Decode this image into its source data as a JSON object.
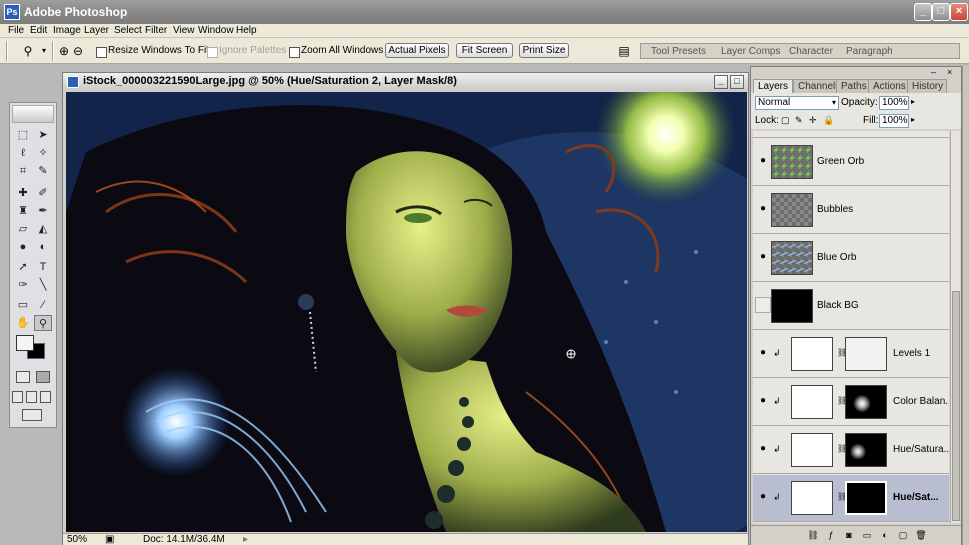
{
  "app": {
    "title": "Adobe Photoshop",
    "logo_text": "Ps"
  },
  "menu": [
    "File",
    "Edit",
    "Image",
    "Layer",
    "Select",
    "Filter",
    "View",
    "Window",
    "Help"
  ],
  "options": {
    "zoom_icon": "zoom-icon",
    "resize_windows": "Resize Windows To Fit",
    "ignore_palettes": "Ignore Palettes",
    "zoom_all_windows": "Zoom All Windows",
    "actual_pixels": "Actual Pixels",
    "fit_screen": "Fit Screen",
    "print_size": "Print Size"
  },
  "palette_well": [
    "Tool Presets",
    "Layer Comps",
    "Character",
    "Paragraph"
  ],
  "document": {
    "title": "iStock_000003221590Large.jpg @ 50% (Hue/Saturation 2, Layer Mask/8)",
    "zoom": "50%",
    "doc_size": "Doc: 14.1M/36.4M"
  },
  "layers_panel": {
    "tabs": [
      "Layers",
      "Channels",
      "Paths",
      "Actions",
      "History"
    ],
    "blend_mode": "Normal",
    "opacity_label": "Opacity:",
    "opacity": "100%",
    "lock_label": "Lock:",
    "fill_label": "Fill:",
    "fill": "100%",
    "layers": [
      {
        "name": "Green Orb",
        "visible": true
      },
      {
        "name": "Bubbles",
        "visible": true
      },
      {
        "name": "Blue Orb",
        "visible": true
      },
      {
        "name": "Black BG",
        "visible": false
      },
      {
        "name": "Levels 1",
        "visible": true
      },
      {
        "name": "Color Balan...",
        "visible": true
      },
      {
        "name": "Hue/Satura...",
        "visible": true
      },
      {
        "name": "Hue/Sat...",
        "visible": true,
        "selected": true
      }
    ]
  },
  "colors": {
    "titlebar": "#8a8a8a",
    "chrome": "#ece9d8",
    "selected_layer": "#b8bed0"
  }
}
